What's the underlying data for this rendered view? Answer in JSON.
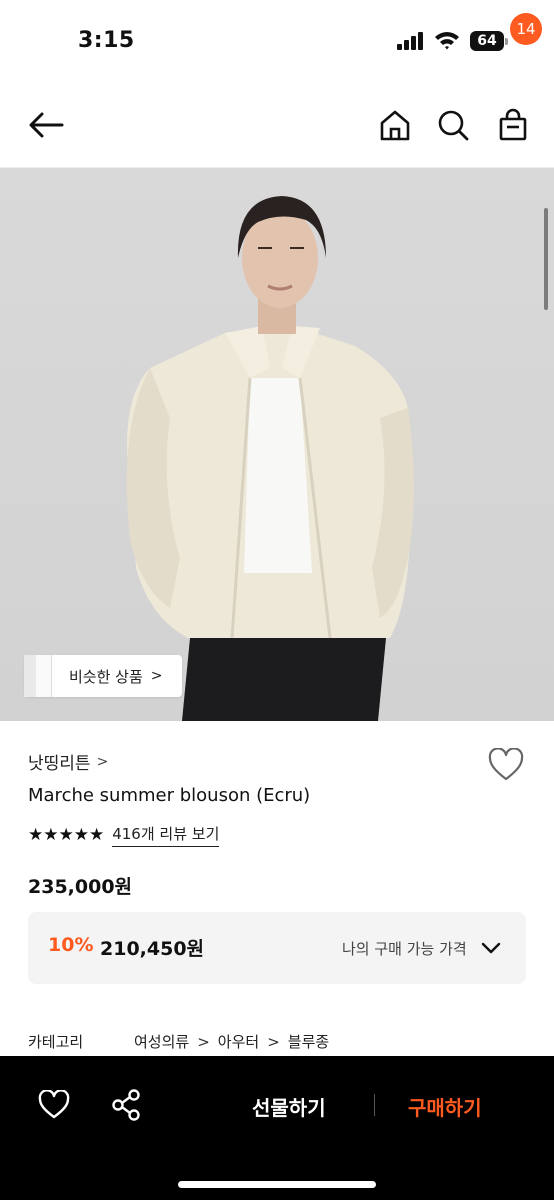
{
  "status_bar": {
    "time": "3:15",
    "battery": "64"
  },
  "header": {
    "cart_count": "14"
  },
  "image": {
    "similar_label": "비슷한 상품",
    "similar_arrow": ">"
  },
  "product": {
    "brand": "낫띵리튼",
    "brand_arrow": ">",
    "name": "Marche summer blouson (Ecru)",
    "stars": "★★★★★",
    "rating": 5,
    "review_link": "416개 리뷰 보기",
    "price": "235,000원",
    "discount": "10%",
    "sale_price": "210,450원",
    "my_price_label": "나의 구매 가능 가격"
  },
  "category": {
    "label": "카테고리",
    "path": [
      "여성의류",
      "아우터",
      "블루종"
    ],
    "separator": ">"
  },
  "bottom_bar": {
    "gift_label": "선물하기",
    "buy_label": "구매하기"
  },
  "colors": {
    "accent": "#ff5a1f",
    "bar_bg": "#000000",
    "price_box_bg": "#f4f4f4"
  }
}
